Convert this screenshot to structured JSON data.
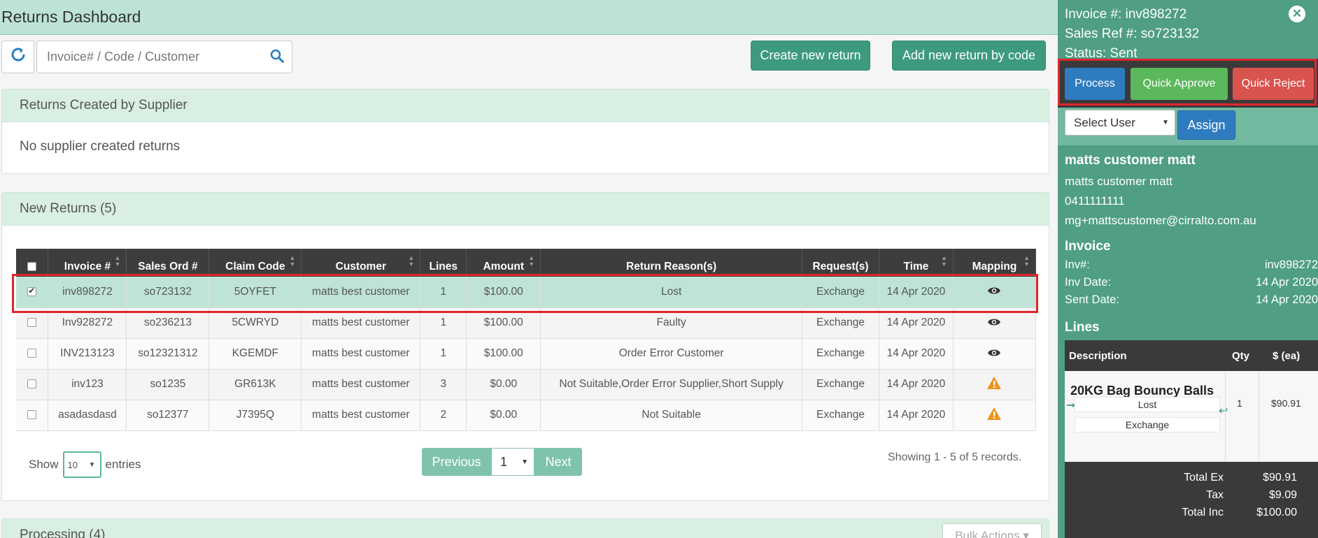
{
  "app": {
    "title": "Returns Dashboard"
  },
  "search": {
    "placeholder": "Invoice# / Code / Customer"
  },
  "toolbar": {
    "create_label": "Create new return",
    "add_by_code_label": "Add new return by code"
  },
  "supplier_panel": {
    "title": "Returns Created by Supplier",
    "empty_text": "No supplier created returns"
  },
  "new_returns": {
    "title": "New Returns (5)",
    "columns": [
      "Invoice #",
      "Sales Ord #",
      "Claim Code",
      "Customer",
      "Lines",
      "Amount",
      "Return Reason(s)",
      "Request(s)",
      "Time",
      "Mapping"
    ],
    "rows": [
      {
        "invoice": "inv898272",
        "sales_ord": "so723132",
        "claim": "5OYFET",
        "customer": "matts best customer",
        "lines": "1",
        "amount": "$100.00",
        "reason": "Lost",
        "request": "Exchange",
        "time": "14 Apr 2020",
        "mapping": "eye-icon",
        "checked": true
      },
      {
        "invoice": "Inv928272",
        "sales_ord": "so236213",
        "claim": "5CWRYD",
        "customer": "matts best customer",
        "lines": "1",
        "amount": "$100.00",
        "reason": "Faulty",
        "request": "Exchange",
        "time": "14 Apr 2020",
        "mapping": "eye-icon",
        "checked": false
      },
      {
        "invoice": "INV213123",
        "sales_ord": "so12321312",
        "claim": "KGEMDF",
        "customer": "matts best customer",
        "lines": "1",
        "amount": "$100.00",
        "reason": "Order Error Customer",
        "request": "Exchange",
        "time": "14 Apr 2020",
        "mapping": "eye-icon",
        "checked": false
      },
      {
        "invoice": "inv123",
        "sales_ord": "so1235",
        "claim": "GR613K",
        "customer": "matts best customer",
        "lines": "3",
        "amount": "$0.00",
        "reason": "Not Suitable,Order Error Supplier,Short Supply",
        "request": "Exchange",
        "time": "14 Apr 2020",
        "mapping": "warning-icon",
        "checked": false
      },
      {
        "invoice": "asadasdasd",
        "sales_ord": "so12377",
        "claim": "J7395Q",
        "customer": "matts best customer",
        "lines": "2",
        "amount": "$0.00",
        "reason": "Not Suitable",
        "request": "Exchange",
        "time": "14 Apr 2020",
        "mapping": "warning-icon",
        "checked": false
      }
    ],
    "show_label": "Show",
    "entries_value": "10",
    "entries_label": "entries",
    "prev_label": "Previous",
    "page_value": "1",
    "next_label": "Next",
    "showing_text": "Showing 1 - 5 of 5 records."
  },
  "processing": {
    "title": "Processing (4)",
    "bulk_label": "Bulk Actions ▾"
  },
  "sidebar": {
    "invoice_line": "Invoice #: inv898272",
    "sales_ref_line": "Sales Ref #: so723132",
    "status_line": "Status: Sent",
    "process_label": "Process",
    "approve_label": "Quick Approve",
    "reject_label": "Quick Reject",
    "user_select_value": "Select User",
    "assign_label": "Assign",
    "customer_title": "matts customer matt",
    "customer_name": "matts customer matt",
    "customer_phone": "0411111111",
    "customer_email": "mg+mattscustomer@cirralto.com.au",
    "invoice_title": "Invoice",
    "invoice_fields": [
      {
        "key": "Inv#:",
        "value": "inv898272"
      },
      {
        "key": "Inv Date:",
        "value": "14 Apr 2020"
      },
      {
        "key": "Sent Date:",
        "value": "14 Apr 2020"
      }
    ],
    "lines_title": "Lines",
    "lines_cols": {
      "desc": "Description",
      "qty": "Qty",
      "price": "$ (ea)"
    },
    "line_item": {
      "name": "20KG Bag Bouncy Balls",
      "reason": "Lost",
      "request": "Exchange",
      "qty": "1",
      "price": "$90.91"
    },
    "totals": [
      {
        "label": "Total Ex",
        "value": "$90.91"
      },
      {
        "label": "Tax",
        "value": "$9.09"
      },
      {
        "label": "Total Inc",
        "value": "$100.00"
      }
    ]
  },
  "colors": {
    "accent": "#3d9a7f",
    "sidebar": "#4f9e85",
    "process": "#2f7bbf",
    "approve": "#5cb85c",
    "reject": "#d9534f",
    "highlight": "#e0262b"
  }
}
